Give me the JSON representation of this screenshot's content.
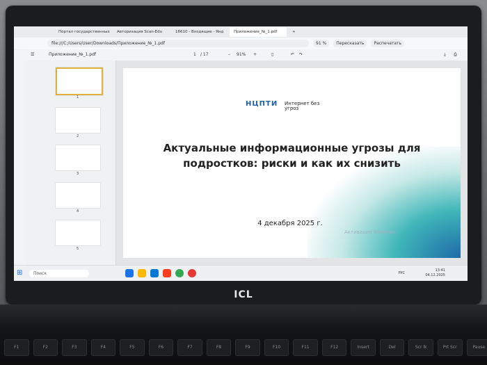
{
  "browser": {
    "tabs": [
      "Портал государственных",
      "Авторизация Scan-Edu",
      "16610 - Входящие - Янд",
      "Приложение_№_1.pdf"
    ],
    "url": "file:///C:/Users/User/Downloads/Приложение_№_1.pdf",
    "zoom": "91 %",
    "retell_label": "Пересказать",
    "print_label": "Распечатать"
  },
  "pdf_toolbar": {
    "file_name": "Приложение_№_1.pdf",
    "page_current": "1",
    "page_total": "/ 17",
    "zoom": "91%"
  },
  "thumbnails": [
    "1",
    "2",
    "3",
    "4",
    "5"
  ],
  "slide": {
    "logo_main": "НЦПТИ",
    "logo_sub": "Интернет без угроз",
    "title": "Актуальные информационные угрозы для подростков: риски и как их снизить",
    "date": "4 декабря 2025 г.",
    "watermark": "Активация Windows"
  },
  "taskbar": {
    "search_placeholder": "Поиск",
    "time": "13:41",
    "date": "04.12.2025",
    "lang": "РУС"
  },
  "laptop": {
    "brand": "ICL",
    "fkeys": [
      "F1",
      "F2",
      "F3",
      "F4",
      "F5",
      "F6",
      "F7",
      "F8",
      "F9",
      "F10",
      "F11",
      "F12",
      "Insert",
      "Del",
      "Scr lk",
      "Prt Scr",
      "Pause"
    ]
  },
  "colors": {
    "accent": "#1e5fa3",
    "teal": "#3fb6b9"
  }
}
